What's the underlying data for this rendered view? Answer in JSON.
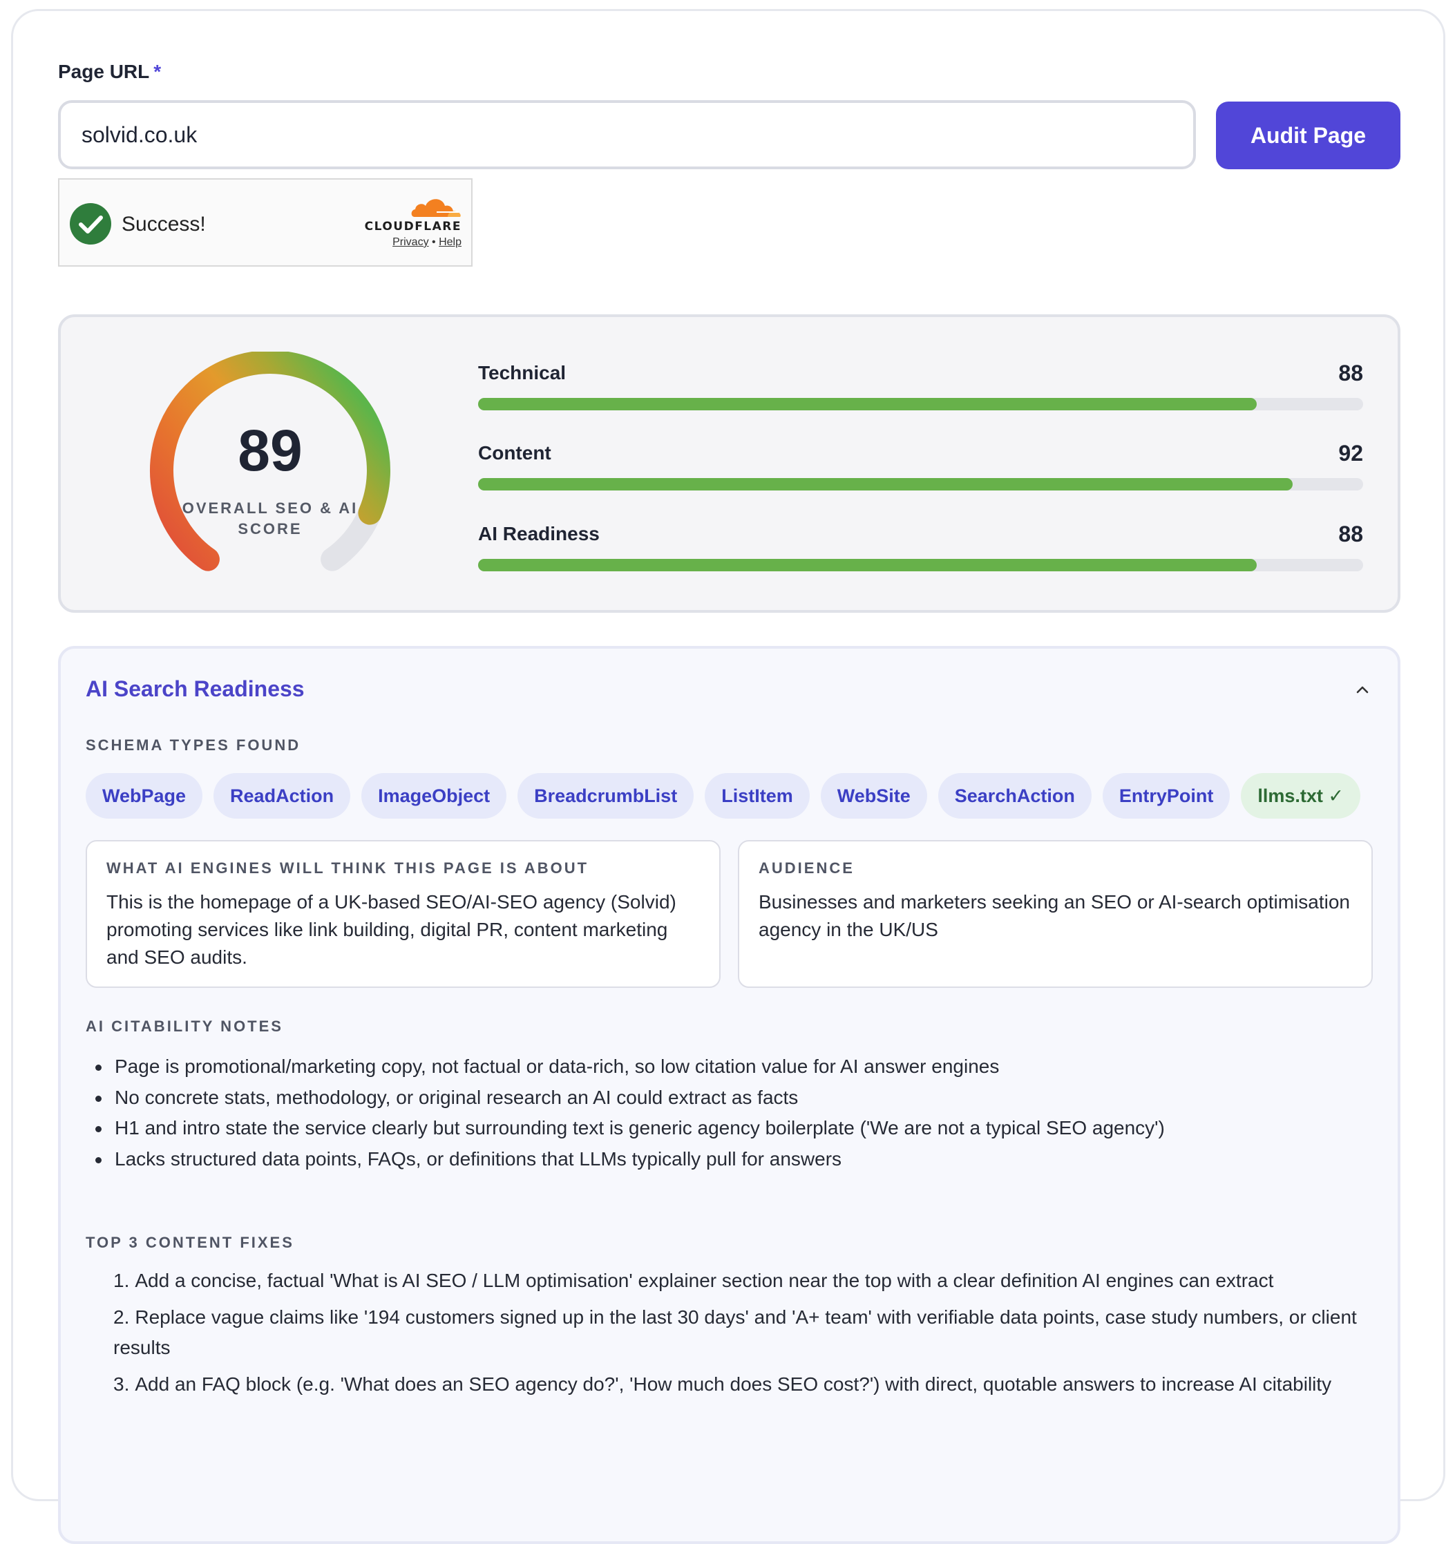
{
  "form": {
    "url_label": "Page URL",
    "required_mark": "*",
    "url_value": "solvid.co.uk",
    "audit_button": "Audit Page"
  },
  "captcha": {
    "status": "Success!",
    "brand": "CLOUDFLARE",
    "privacy_link": "Privacy",
    "separator": "•",
    "help_link": "Help",
    "brand_color": "#f38020"
  },
  "scores": {
    "overall": {
      "value": "89",
      "caption": "OVERALL SEO & AI SCORE",
      "fraction": 0.89
    },
    "metrics": [
      {
        "name": "Technical",
        "value": "88",
        "fraction": 0.88
      },
      {
        "name": "Content",
        "value": "92",
        "fraction": 0.92
      },
      {
        "name": "AI Readiness",
        "value": "88",
        "fraction": 0.88
      }
    ],
    "bar_color": "#67b14a"
  },
  "ai_readiness": {
    "title": "AI Search Readiness",
    "schema_caption": "SCHEMA TYPES FOUND",
    "schema_types": [
      "WebPage",
      "ReadAction",
      "ImageObject",
      "BreadcrumbList",
      "ListItem",
      "WebSite",
      "SearchAction",
      "EntryPoint"
    ],
    "llms_chip": "llms.txt ✓",
    "about": {
      "caption": "WHAT AI ENGINES WILL THINK THIS PAGE IS ABOUT",
      "text": "This is the homepage of a UK-based SEO/AI-SEO agency (Solvid) promoting services like link building, digital PR, content marketing and SEO audits."
    },
    "audience": {
      "caption": "AUDIENCE",
      "text": "Businesses and marketers seeking an SEO or AI-search optimisation agency in the UK/US"
    },
    "citability_caption": "AI CITABILITY NOTES",
    "citability_notes": [
      "Page is promotional/marketing copy, not factual or data-rich, so low citation value for AI answer engines",
      "No concrete stats, methodology, or original research an AI could extract as facts",
      "H1 and intro state the service clearly but surrounding text is generic agency boilerplate ('We are not a typical SEO agency')",
      "Lacks structured data points, FAQs, or definitions that LLMs typically pull for answers"
    ],
    "fixes_caption": "TOP 3 CONTENT FIXES",
    "fixes": [
      "Add a concise, factual 'What is AI SEO / LLM optimisation' explainer section near the top with a clear definition AI engines can extract",
      "Replace vague claims like '194 customers signed up in the last 30 days' and 'A+ team' with verifiable data points, case study numbers, or client results",
      "Add an FAQ block (e.g. 'What does an SEO agency do?', 'How much does SEO cost?') with direct, quotable answers to increase AI citability"
    ]
  }
}
